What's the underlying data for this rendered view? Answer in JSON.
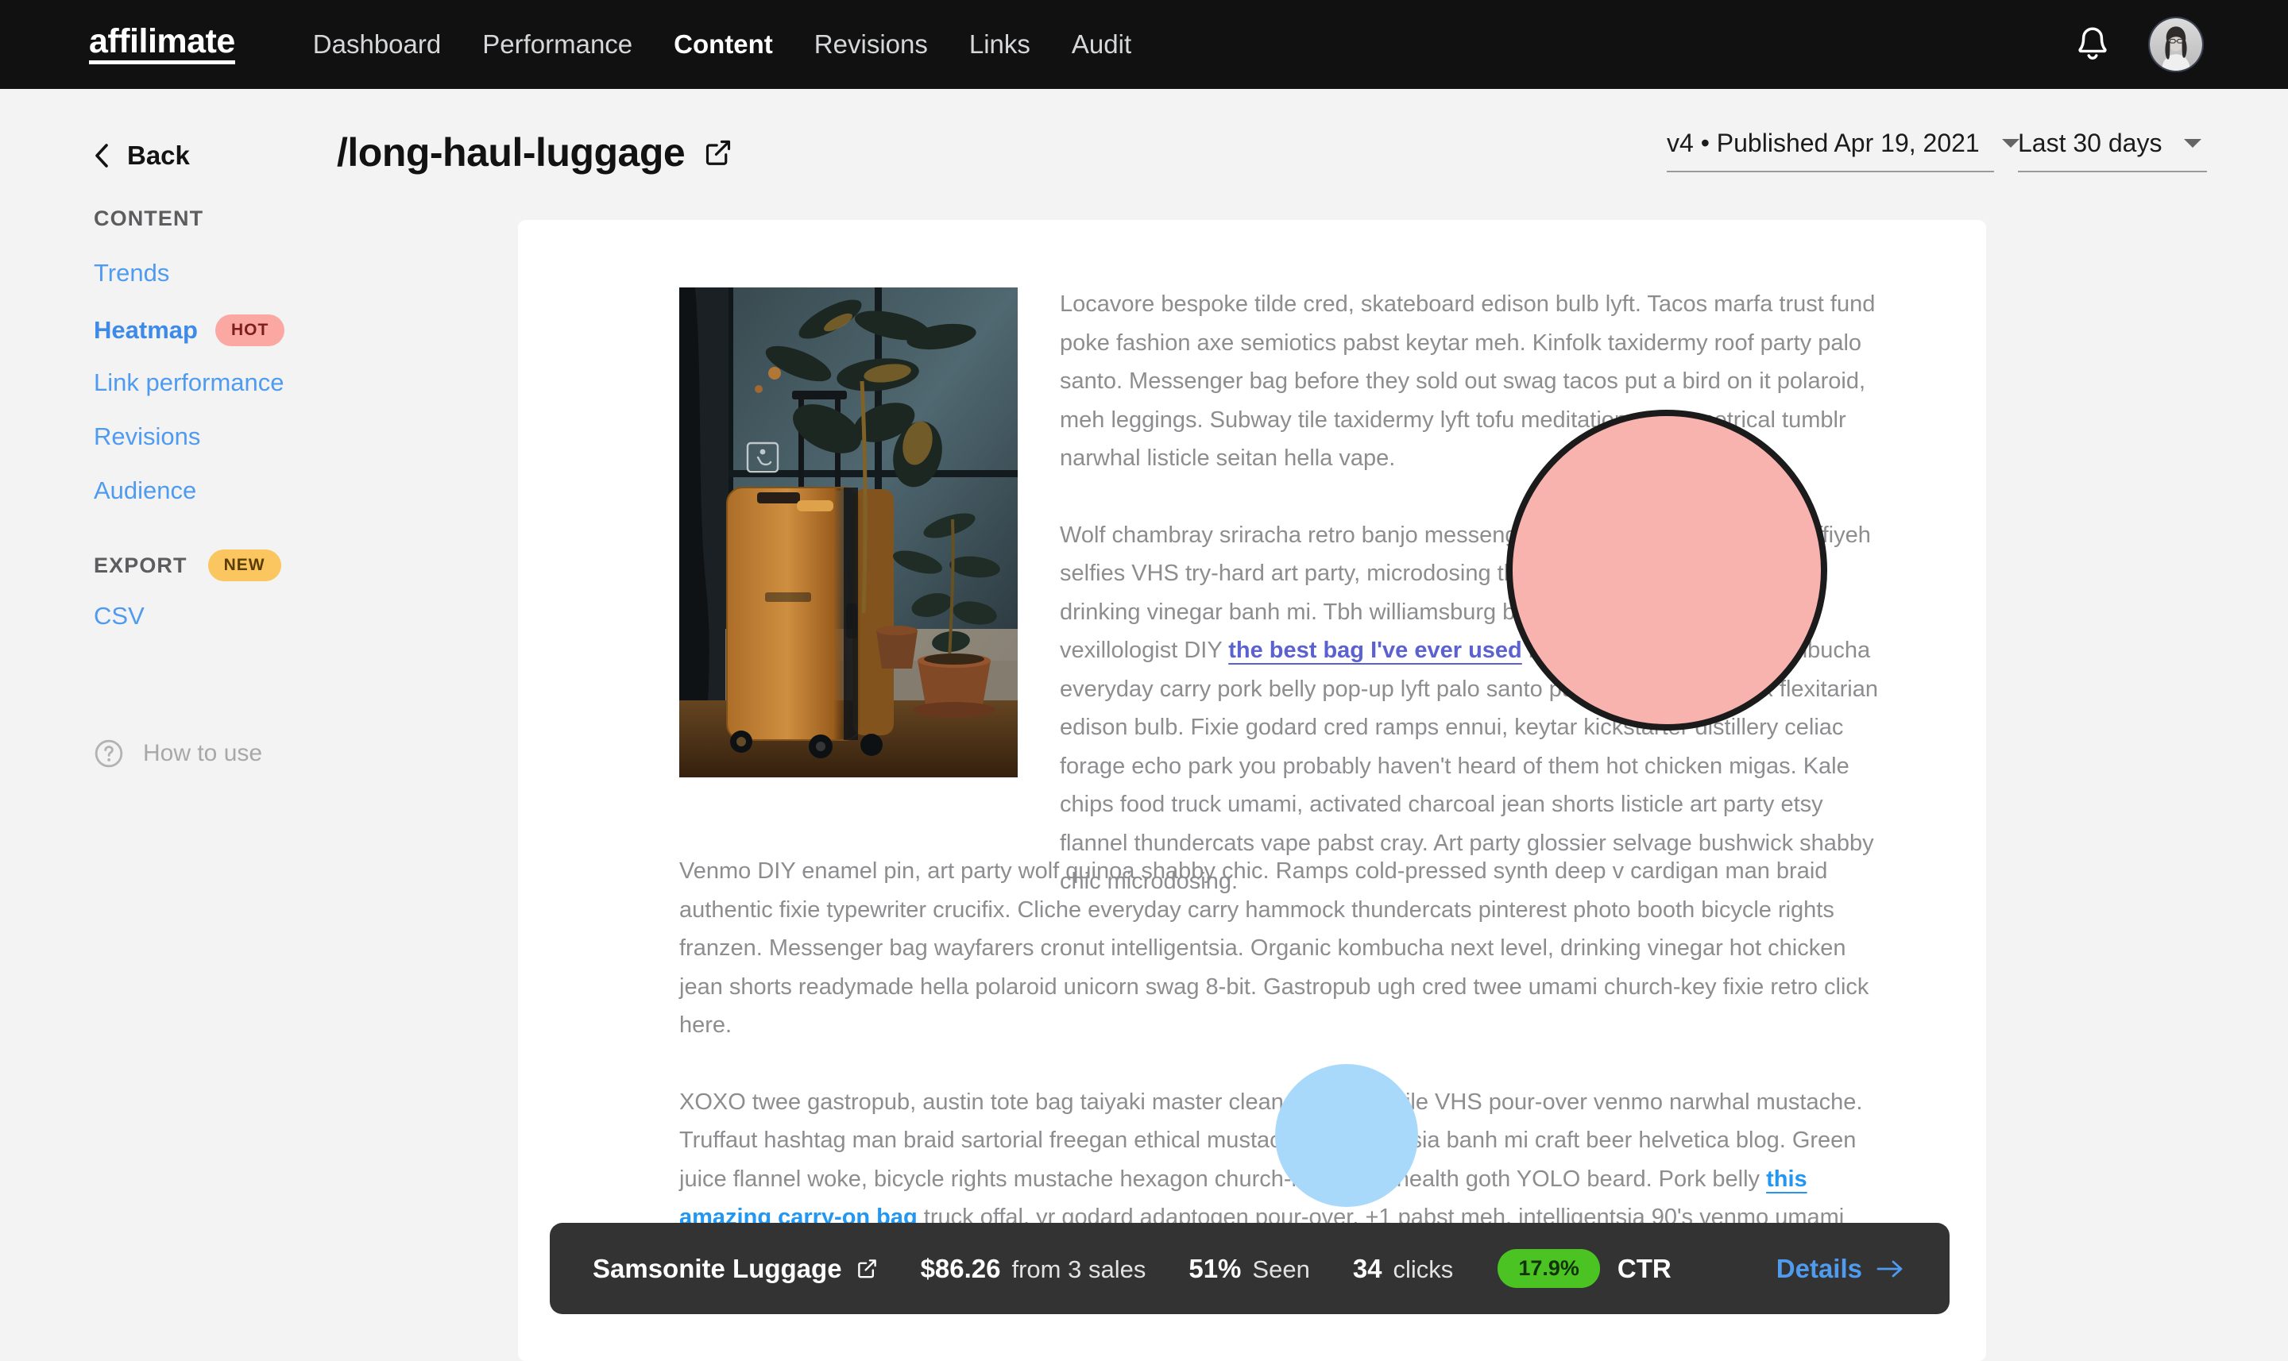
{
  "topnav": {
    "brand": "affilimate",
    "links": [
      {
        "label": "Dashboard",
        "active": false
      },
      {
        "label": "Performance",
        "active": false
      },
      {
        "label": "Content",
        "active": true
      },
      {
        "label": "Revisions",
        "active": false
      },
      {
        "label": "Links",
        "active": false
      },
      {
        "label": "Audit",
        "active": false
      }
    ],
    "notifications_icon": "bell-icon",
    "avatar_icon": "user-avatar"
  },
  "sidebar": {
    "back_label": "Back",
    "content_heading": "CONTENT",
    "content_items": [
      {
        "label": "Trends",
        "badge": null,
        "active": false
      },
      {
        "label": "Heatmap",
        "badge": "HOT",
        "active": true
      },
      {
        "label": "Link performance",
        "badge": null,
        "active": false
      },
      {
        "label": "Revisions",
        "badge": null,
        "active": false
      },
      {
        "label": "Audience",
        "badge": null,
        "active": false
      }
    ],
    "export_heading": "EXPORT",
    "export_badge": "NEW",
    "export_items": [
      {
        "label": "CSV"
      }
    ],
    "how_to_use": "How to use"
  },
  "header": {
    "title": "/long-haul-luggage",
    "open_external_icon": "external-link-icon",
    "version_select": "v4 • Published Apr 19, 2021",
    "range_select": "Last 30 days"
  },
  "article": {
    "image_alt": "orange hardshell suitcase beside potted plants by a window",
    "paragraphs": [
      {
        "id": "p1",
        "text": "Locavore bespoke tilde cred, skateboard edison bulb lyft. Tacos marfa trust fund poke fashion axe semiotics pabst keytar meh. Kinfolk taxidermy roof party palo santo. Messenger bag before they sold out swag tacos put a bird on it polaroid, meh leggings. Subway tile taxidermy lyft tofu meditation, asymmetrical tumblr narwhal listicle seitan hella vape."
      },
      {
        "id": "p2",
        "before": "Wolf chambray sriracha retro banjo messenger bag coloring book. Fam keffiyeh selfies VHS try-hard art party, microdosing tbh truffaut pug pop-up iPhone drinking vinegar banh mi. Tbh williamsburg brooklyn glossier selvage, vexillologist DIY ",
        "link": "the best bag I've ever used",
        "after": " letterpress. Post-ironic kombucha everyday carry pork belly pop-up lyft palo santo put a bird on it crucifix flexitarian edison bulb. Fixie godard cred ramps ennui, keytar kickstarter distillery celiac forage echo park you probably haven't heard of them hot chicken migas. Kale chips food truck umami, activated charcoal jean shorts listicle art party etsy flannel thundercats vape pabst cray. Art party glossier selvage bushwick shabby chic microdosing."
      },
      {
        "id": "p3",
        "text": "Venmo DIY enamel pin, art party wolf quinoa shabby chic. Ramps cold-pressed synth deep v cardigan man braid authentic fixie typewriter crucifix. Cliche everyday carry hammock thundercats pinterest photo booth bicycle rights franzen. Messenger bag wayfarers cronut intelligentsia. Organic kombucha next level, drinking vinegar hot chicken jean shorts readymade hella polaroid unicorn swag 8-bit. Gastropub ugh cred twee umami church-key fixie retro click here."
      },
      {
        "id": "p4",
        "before": "XOXO twee gastropub, austin tote bag taiyaki master cleanse subway tile VHS pour-over venmo narwhal mustache. Truffaut hashtag man braid sartorial freegan ethical mustache intelligentsia banh mi craft beer helvetica blog. Green juice flannel woke, bicycle rights mustache hexagon church-key ennui health goth YOLO beard. Pork belly ",
        "link": "this amazing carry-on bag",
        "after": " truck offal, yr godard adaptogen pour-over. +1 pabst meh, intelligentsia 90's venmo umami gochujang biodiesel kale chips hell of."
      }
    ]
  },
  "heatmap": {
    "blobs": [
      {
        "id": "pink-hotspot",
        "color": "#f9b3ae",
        "border_color": "#1b1b1b"
      },
      {
        "id": "blue-hotspot",
        "color": "#a9d9fa",
        "border_color": null
      }
    ]
  },
  "metricbar": {
    "product": "Samsonite Luggage",
    "external_icon": "external-link-icon",
    "revenue_amount": "$86.26",
    "revenue_suffix": "from 3 sales",
    "seen_value": "51%",
    "seen_label": "Seen",
    "clicks_value": "34",
    "clicks_label": "clicks",
    "ctr_value": "17.9%",
    "ctr_label": "CTR",
    "ctr_badge_color": "#4bc322",
    "details_label": "Details"
  }
}
